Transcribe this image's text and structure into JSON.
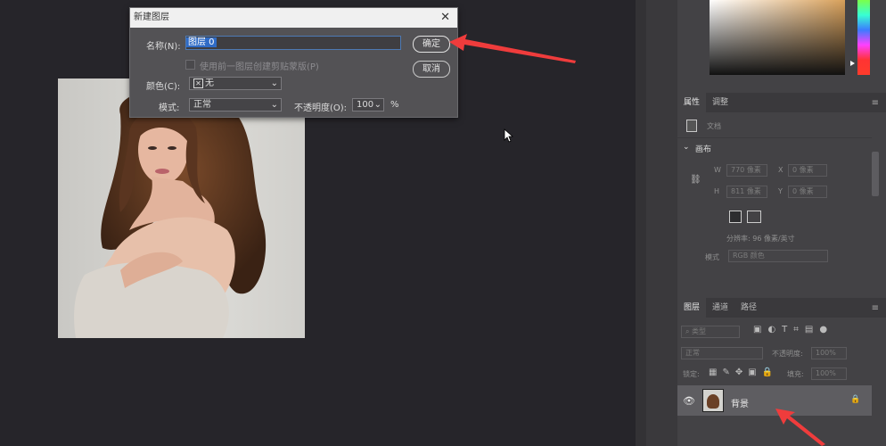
{
  "dialog": {
    "title": "新建图层",
    "name_label": "名称(N):",
    "name_value": "图层 0",
    "clip_checkbox_label": "使用前一图层创建剪贴蒙版(P)",
    "color_label": "颜色(C):",
    "color_value": "无",
    "mode_label": "模式:",
    "mode_value": "正常",
    "opacity_label": "不透明度(O):",
    "opacity_value": "100",
    "opacity_unit": "%",
    "ok_label": "确定",
    "cancel_label": "取消"
  },
  "properties_panel": {
    "tabs": [
      "属性",
      "调整"
    ],
    "doc_label": "文档",
    "canvas_label": "画布",
    "w_label": "W",
    "w_value": "770 像素",
    "h_label": "H",
    "h_value": "811 像素",
    "x_label": "X",
    "x_value": "0 像素",
    "y_label": "Y",
    "y_value": "0 像素",
    "resolution": "分辨率: 96 像素/英寸",
    "mode_label": "模式",
    "mode_value": "RGB 颜色"
  },
  "layers_panel": {
    "tabs": [
      "图层",
      "通道",
      "路径"
    ],
    "kind_filter": "类型",
    "blend_mode": "正常",
    "opacity_label": "不透明度:",
    "opacity_value": "100%",
    "lock_label": "锁定:",
    "fill_label": "填充:",
    "fill_value": "100%",
    "layer_name": "背景"
  },
  "colors": {
    "accent_arrow": "#ef3c3c",
    "selection": "#2f6bc6",
    "workspace": "#26252a"
  }
}
